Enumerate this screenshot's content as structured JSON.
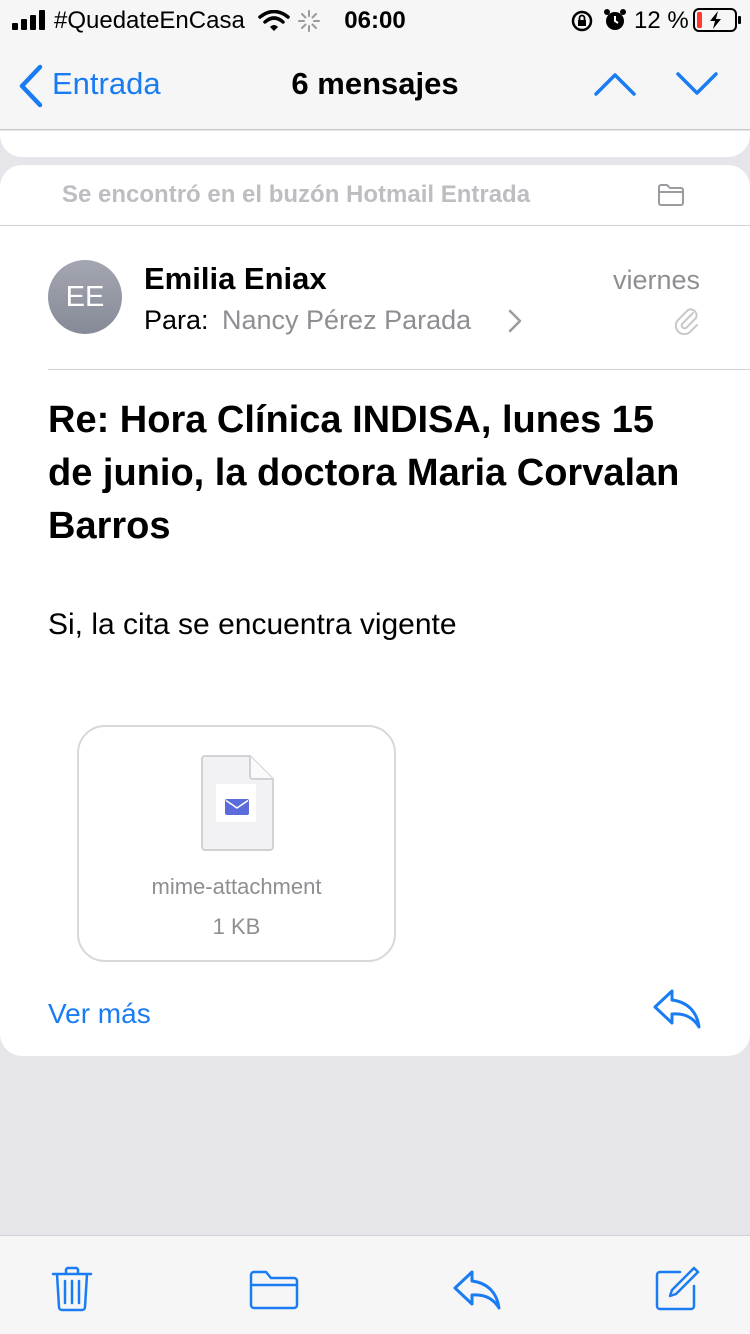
{
  "status_bar": {
    "carrier": "#QuedateEnCasa",
    "time": "06:00",
    "battery_percent": "12 %"
  },
  "nav": {
    "back_label": "Entrada",
    "title": "6 mensajes"
  },
  "message": {
    "found_in": "Se encontró en el buzón Hotmail Entrada",
    "avatar_initials": "EE",
    "sender": "Emilia Eniax",
    "date": "viernes",
    "to_label": "Para:",
    "to_name": "Nancy Pérez Parada",
    "subject": "Re:  Hora Clínica INDISA, lunes 15 de junio, la doctora Maria Corvalan Barros",
    "body": "Si, la cita se encuentra vigente",
    "attachment": {
      "name": "mime-attachment",
      "size": "1 KB"
    },
    "see_more": "Ver más"
  },
  "colors": {
    "accent": "#1a7cf2",
    "background": "#e5e5ea",
    "secondary_text": "#8e8e93"
  },
  "icons": {
    "status": [
      "signal-bars-icon",
      "wifi-icon",
      "activity-spinner-icon",
      "orientation-lock-icon",
      "alarm-icon",
      "battery-charging-icon"
    ],
    "nav": [
      "chevron-left-icon",
      "chevron-up-icon",
      "chevron-down-icon"
    ],
    "message": [
      "folder-icon",
      "paperclip-icon",
      "chevron-right-icon",
      "document-icon",
      "envelope-icon",
      "reply-icon"
    ],
    "toolbar": [
      "trash-icon",
      "folder-icon",
      "reply-icon",
      "compose-icon"
    ]
  }
}
